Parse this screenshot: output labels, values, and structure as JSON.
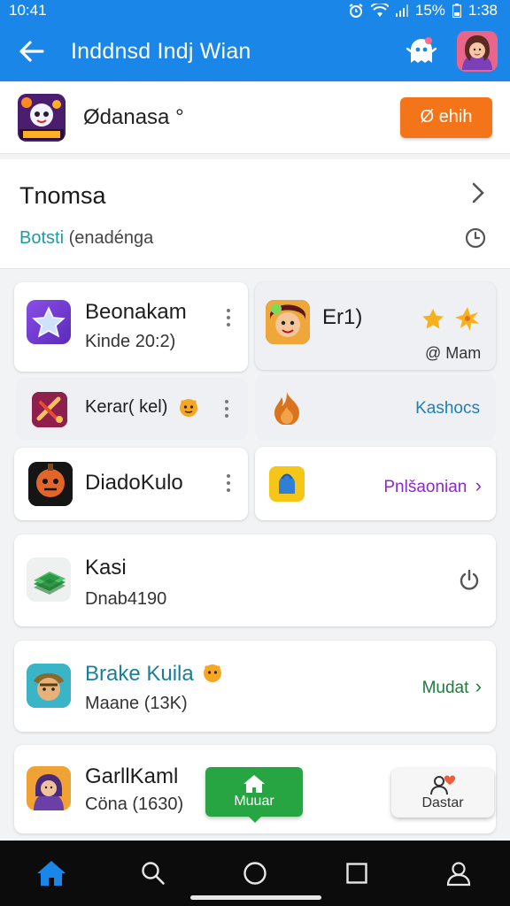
{
  "status_bar": {
    "time": "10:41",
    "battery": "15%",
    "clock_right": "1:38"
  },
  "app_bar": {
    "title": "Inddnsd Indj Wian"
  },
  "header_card": {
    "name": "Ødanasa °",
    "button_label": "Ø ehih"
  },
  "section": {
    "title": "Tnomsa",
    "sub_teal": "Botsti",
    "sub_grey": "(enadénga"
  },
  "tiles": [
    {
      "title": "Beonakam",
      "subtitle": "Kinde 20:2)"
    },
    {
      "title": "Er1)",
      "meta": "@ Mam"
    },
    {
      "title": "Kerar( kel)"
    },
    {
      "link": "Kashocs"
    },
    {
      "title": "DiadoKulo"
    },
    {
      "link": "Pnlšaonian",
      "chev": "›"
    },
    {
      "title": "Kasi",
      "subtitle": "Dnab4190"
    },
    {
      "title": "Brake Kuila",
      "subtitle": "Maane (13K)",
      "link": "Mudat",
      "chev": "›"
    },
    {
      "title": "GarllKaml",
      "subtitle": "Cöna (1630)"
    }
  ],
  "floating": {
    "green_label": "Muuar",
    "grey_label": "Dastar"
  },
  "colors": {
    "primary": "#1a87e8",
    "orange": "#f47419",
    "green": "#27a543",
    "teal": "#1e9aa6",
    "purple": "#8a2bc9",
    "dark_green": "#1e7b3a"
  },
  "nav": {
    "items": [
      "home-icon",
      "search-icon",
      "circle-icon",
      "square-icon",
      "profile-icon"
    ]
  }
}
